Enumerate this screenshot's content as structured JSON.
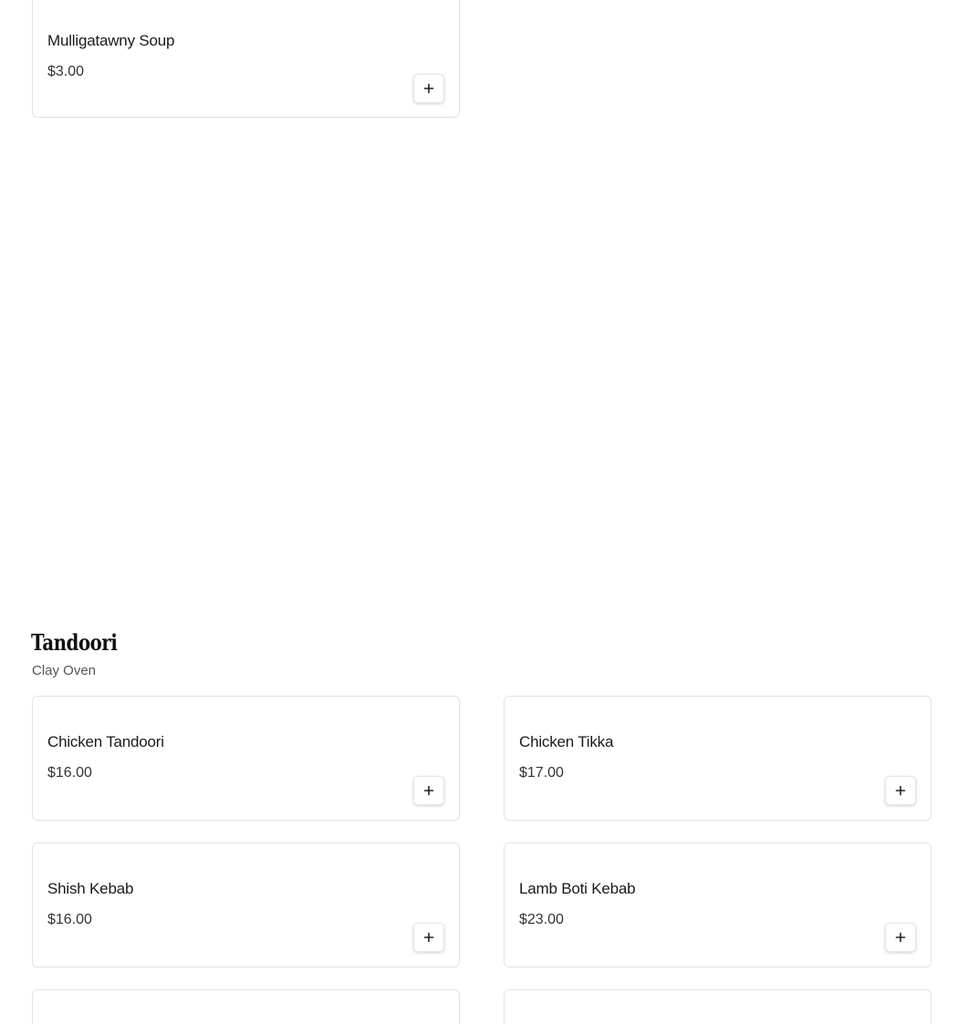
{
  "top_item": {
    "name": "Mulligatawny Soup",
    "price": "$3.00"
  },
  "tandoori": {
    "title": "Tandoori",
    "subtitle": "Clay Oven",
    "items": [
      {
        "name": "Chicken Tandoori",
        "price": "$16.00"
      },
      {
        "name": "Chicken Tikka",
        "price": "$17.00"
      },
      {
        "name": "Shish Kebab",
        "price": "$16.00"
      },
      {
        "name": "Lamb Boti Kebab",
        "price": "$23.00"
      }
    ]
  },
  "icons": {
    "add": "plus-icon"
  }
}
